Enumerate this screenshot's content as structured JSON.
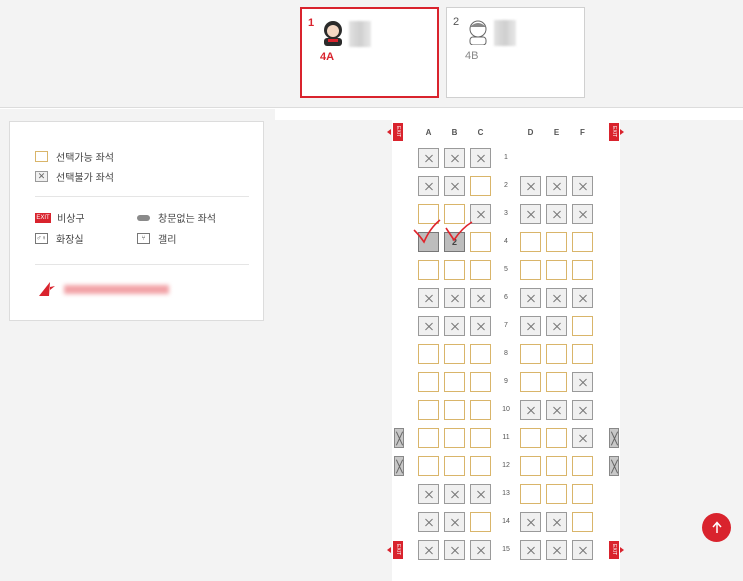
{
  "passengers": [
    {
      "number": "1",
      "seat": "4A",
      "active": true
    },
    {
      "number": "2",
      "seat": "4B",
      "active": false
    }
  ],
  "legend": {
    "available": "선택가능 좌석",
    "unavailable": "선택불가 좌석",
    "exit": "비상구",
    "exit_icon_text": "EXIT",
    "no_window": "창문없는 좌석",
    "lavatory": "화장실",
    "galley": "갤리"
  },
  "seatmap": {
    "exit_text": "EXIT",
    "columns_left": [
      "A",
      "B",
      "C"
    ],
    "columns_right": [
      "D",
      "E",
      "F"
    ],
    "rows": [
      {
        "num": "1",
        "seats": [
          "x",
          "x",
          "x",
          "",
          "",
          ""
        ]
      },
      {
        "num": "2",
        "seats": [
          "x",
          "x",
          "o",
          "x",
          "x",
          "x"
        ]
      },
      {
        "num": "3",
        "seats": [
          "o",
          "o",
          "x",
          "x",
          "x",
          "x"
        ]
      },
      {
        "num": "4",
        "seats": [
          "s1",
          "s2",
          "o",
          "o",
          "o",
          "o"
        ]
      },
      {
        "num": "5",
        "seats": [
          "o",
          "o",
          "o",
          "o",
          "o",
          "o"
        ]
      },
      {
        "num": "6",
        "seats": [
          "x",
          "x",
          "x",
          "x",
          "x",
          "x"
        ]
      },
      {
        "num": "7",
        "seats": [
          "x",
          "x",
          "x",
          "x",
          "x",
          "o"
        ]
      },
      {
        "num": "8",
        "seats": [
          "o",
          "o",
          "o",
          "o",
          "o",
          "o"
        ]
      },
      {
        "num": "9",
        "seats": [
          "o",
          "o",
          "o",
          "o",
          "o",
          "x"
        ]
      },
      {
        "num": "10",
        "seats": [
          "o",
          "o",
          "o",
          "x",
          "x",
          "x"
        ]
      },
      {
        "num": "11",
        "seats": [
          "o",
          "o",
          "o",
          "o",
          "o",
          "x"
        ]
      },
      {
        "num": "12",
        "seats": [
          "o",
          "o",
          "o",
          "o",
          "o",
          "o"
        ]
      },
      {
        "num": "13",
        "seats": [
          "x",
          "x",
          "x",
          "o",
          "o",
          "o"
        ]
      },
      {
        "num": "14",
        "seats": [
          "x",
          "x",
          "o",
          "x",
          "x",
          "o"
        ]
      },
      {
        "num": "15",
        "seats": [
          "x",
          "x",
          "x",
          "x",
          "x",
          "x"
        ]
      }
    ],
    "selected_label_b": "2"
  },
  "colors": {
    "accent": "#d9232d",
    "available_border": "#d9b56a",
    "selected_fill": "#bdbdbd"
  }
}
